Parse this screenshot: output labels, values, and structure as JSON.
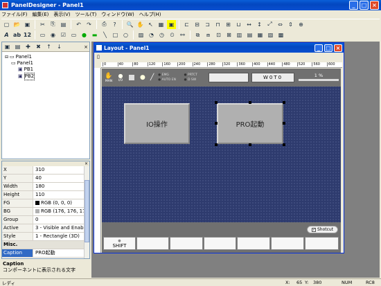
{
  "app": {
    "title": "PanelDesigner - Panel1"
  },
  "menu": [
    "ファイル(F)",
    "編集(E)",
    "表示(V)",
    "ツール(T)",
    "ウィンドウ(W)",
    "ヘルプ(H)"
  ],
  "tree": {
    "root": "Panel1",
    "panel": "Panel1",
    "items": [
      "PB1",
      "PB2"
    ]
  },
  "props": [
    {
      "k": "X",
      "v": "310"
    },
    {
      "k": "Y",
      "v": "40"
    },
    {
      "k": "Width",
      "v": "180"
    },
    {
      "k": "Height",
      "v": "110"
    },
    {
      "k": "FG",
      "v": "RGB (0, 0, 0)"
    },
    {
      "k": "BG",
      "v": "RGB (176, 176, 176)"
    },
    {
      "k": "Group",
      "v": "0"
    },
    {
      "k": "Active",
      "v": "3 - Visible and Enabled"
    },
    {
      "k": "Style",
      "v": "1 - Rectangle (3D)"
    }
  ],
  "misc": {
    "label": "Misc.",
    "caption_key": "Caption",
    "caption_val": "PRO起動"
  },
  "help": {
    "title": "Caption",
    "desc": "コンポーネントに表示される文字"
  },
  "layout": {
    "title": "Layout - Panel1",
    "ruler": [
      "0",
      "40",
      "80",
      "120",
      "160",
      "200",
      "240",
      "280",
      "320",
      "360",
      "400",
      "440",
      "480",
      "520",
      "560",
      "600"
    ],
    "hdr": {
      "man": "MAN",
      "io": "I/O",
      "emg": "EMG",
      "prtct": "PRTCT",
      "autoen": "AUTO EN",
      "dsw": "D SW",
      "center": "W0T0",
      "pct": "1 %"
    },
    "buttons": {
      "pb1": "IO操作",
      "pb2": "PRO起動"
    },
    "shotcut": "Shotcut",
    "shift": "SHIFT"
  },
  "status": {
    "left": "レディ",
    "x": "X:",
    "xv": "65",
    "y": "Y:",
    "yv": "380",
    "num": "NUM",
    "rc": "RC8"
  }
}
